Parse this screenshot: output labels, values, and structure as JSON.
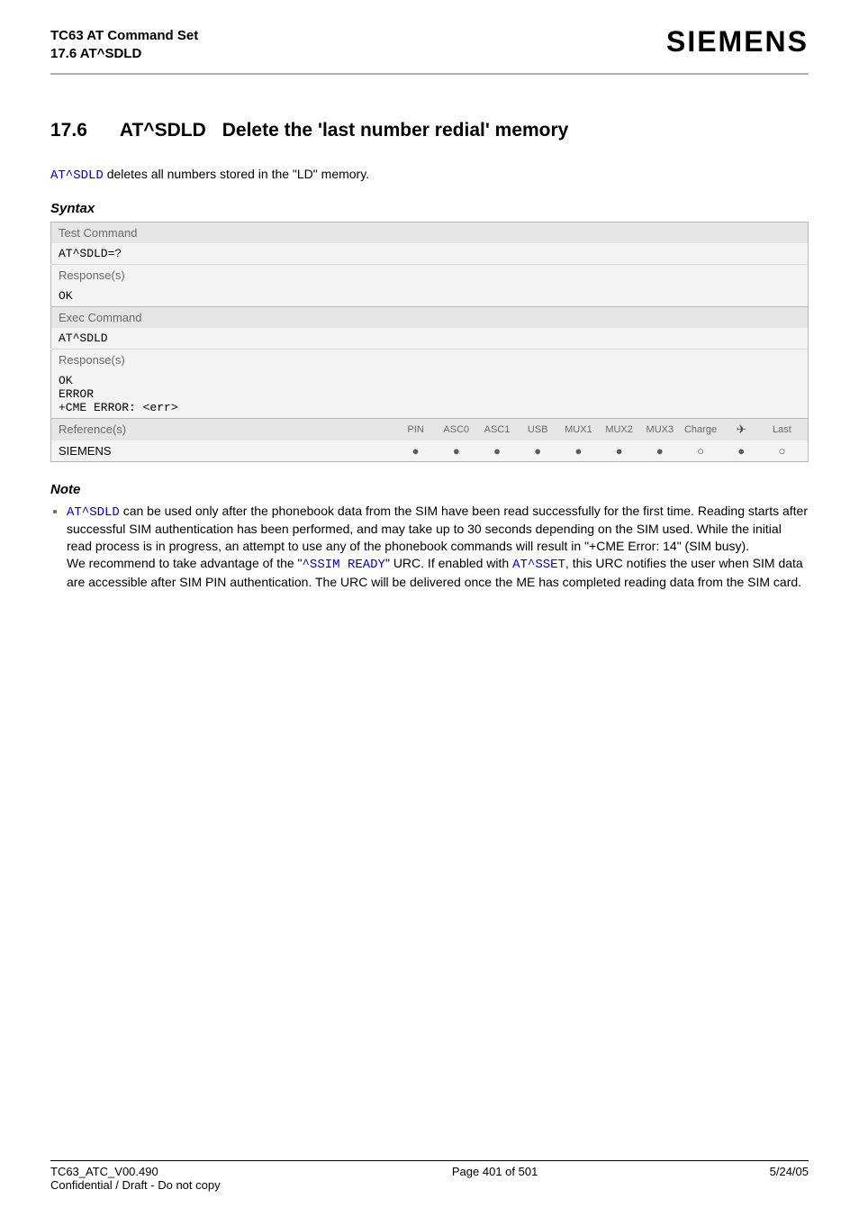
{
  "header": {
    "title_line1": "TC63 AT Command Set",
    "title_line2": "17.6 AT^SDLD",
    "logo": "SIEMENS"
  },
  "section": {
    "number": "17.6",
    "command": "AT^SDLD",
    "title": "Delete the 'last number redial' memory"
  },
  "intro": {
    "cmd_link": "AT^SDLD",
    "text_after": " deletes all numbers stored in the \"LD\" memory."
  },
  "syntax": {
    "label": "Syntax",
    "test_command_label": "Test Command",
    "test_command_code": "AT^SDLD=?",
    "responses_label": "Response(s)",
    "test_response_code": "OK",
    "exec_command_label": "Exec Command",
    "exec_command_code": "AT^SDLD",
    "exec_responses": [
      "OK",
      "ERROR",
      "+CME ERROR: <err>"
    ],
    "references_label": "Reference(s)",
    "columns": [
      "PIN",
      "ASC0",
      "ASC1",
      "USB",
      "MUX1",
      "MUX2",
      "MUX3",
      "Charge",
      "✈",
      "Last"
    ],
    "vendor": "SIEMENS",
    "availability": [
      "filled",
      "filled",
      "filled",
      "filled",
      "filled",
      "filled",
      "filled",
      "open",
      "filled",
      "open"
    ]
  },
  "note": {
    "label": "Note",
    "item_parts": {
      "p1_cmd": "AT^SDLD",
      "p1_rest": " can be used only after the phonebook data from the SIM have been read successfully for the first time. Reading starts after successful SIM authentication has been performed, and may take up to 30 seconds depending on the SIM used. While the initial read process is in progress, an attempt to use any of the phonebook commands will result in \"+CME Error: 14\" (SIM busy).",
      "p2_a": "We recommend to take advantage of the \"",
      "p2_urc": "^SSIM READY",
      "p2_b": "\" URC. If enabled with ",
      "p2_sset": "AT^SSET",
      "p2_c": ", this URC notifies the user when SIM data are accessible after SIM PIN authentication. The URC will be delivered once the ME has completed reading data from the SIM card."
    }
  },
  "footer": {
    "left_line1": "TC63_ATC_V00.490",
    "left_line2": "Confidential / Draft - Do not copy",
    "center": "Page 401 of 501",
    "right": "5/24/05"
  }
}
